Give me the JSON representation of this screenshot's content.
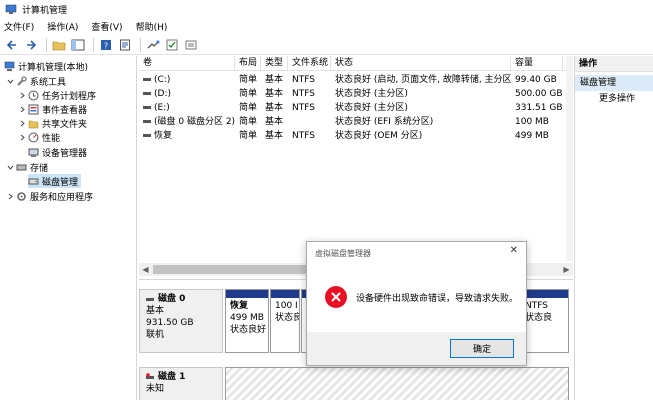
{
  "window": {
    "title": "计算机管理"
  },
  "menu": [
    "文件(F)",
    "操作(A)",
    "查看(V)",
    "帮助(H)"
  ],
  "toolbar": {
    "icons": [
      "back-arrow-icon",
      "forward-arrow-icon",
      "folder-up-icon",
      "console-tree-icon",
      "help-icon",
      "properties-icon",
      "connect-icon",
      "check-icon",
      "view-icon"
    ]
  },
  "tree": {
    "root": "计算机管理(本地)",
    "system_tools": "系统工具",
    "task_scheduler": "任务计划程序",
    "event_viewer": "事件查看器",
    "shared_folders": "共享文件夹",
    "performance": "性能",
    "device_manager": "设备管理器",
    "storage": "存储",
    "disk_management": "磁盘管理",
    "services_apps": "服务和应用程序"
  },
  "volume_table": {
    "columns": [
      "卷",
      "布局",
      "类型",
      "文件系统",
      "状态",
      "容量",
      "可"
    ],
    "rows": [
      {
        "volume": "(C:)",
        "layout": "简单",
        "type": "基本",
        "fs": "NTFS",
        "status": "状态良好 (启动, 页面文件, 故障转储, 主分区)",
        "capacity": "99.40 GB",
        "free": "6"
      },
      {
        "volume": "(D:)",
        "layout": "简单",
        "type": "基本",
        "fs": "NTFS",
        "status": "状态良好 (主分区)",
        "capacity": "500.00 GB",
        "free": "2"
      },
      {
        "volume": "(E:)",
        "layout": "简单",
        "type": "基本",
        "fs": "NTFS",
        "status": "状态良好 (主分区)",
        "capacity": "331.51 GB",
        "free": "2"
      },
      {
        "volume": "(磁盘 0 磁盘分区 2)",
        "layout": "简单",
        "type": "基本",
        "fs": "",
        "status": "状态良好 (EFI 系统分区)",
        "capacity": "100 MB",
        "free": "1"
      },
      {
        "volume": "恢复",
        "layout": "简单",
        "type": "基本",
        "fs": "NTFS",
        "status": "状态良好 (OEM 分区)",
        "capacity": "499 MB",
        "free": "1"
      }
    ]
  },
  "disk0": {
    "name": "磁盘 0",
    "type": "基本",
    "size": "931.50 GB",
    "state": "联机",
    "partitions": [
      {
        "name": "恢复",
        "size": "499 MB",
        "status": "状态良好"
      },
      {
        "name": "",
        "size": "100 I",
        "status": "状态良"
      },
      {
        "name": "",
        "size": "NTFS",
        "status": "状态良"
      }
    ]
  },
  "disk1": {
    "name": "磁盘 1",
    "type": "未知"
  },
  "actions": {
    "header": "操作",
    "selected": "磁盘管理",
    "more": "更多操作"
  },
  "dialog": {
    "title": "虚拟磁盘管理器",
    "message": "设备硬件出现致命错误，导致请求失败。",
    "ok": "确定"
  },
  "colors": {
    "selection": "#cce4f7",
    "partition_bar": "#1f3b8c",
    "error": "#e81123",
    "button_border": "#0078d7"
  }
}
